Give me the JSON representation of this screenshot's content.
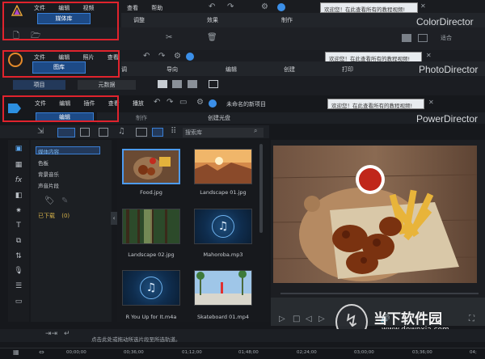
{
  "colordirector": {
    "brand": "ColorDirector",
    "menu": [
      "文件",
      "编辑",
      "视频"
    ],
    "menu_right": [
      "查看",
      "帮助"
    ],
    "library_tab": "媒体库",
    "modes": [
      "调整",
      "效果",
      "制作"
    ],
    "notice": "欢迎您！在此查看所有的教程视频!",
    "fit_select": "适合"
  },
  "photodirector": {
    "brand": "PhotoDirector",
    "menu": [
      "文件",
      "编辑",
      "照片",
      "查看"
    ],
    "library_tab": "图库",
    "modes": [
      "调",
      "导向",
      "编辑",
      "创建",
      "打印"
    ],
    "sub_tabs": [
      "项目",
      "元数据"
    ],
    "notice": "欢迎您！在此查看所有的教程视频!"
  },
  "powerdirector": {
    "brand": "PowerDirector",
    "menu": [
      "文件",
      "编辑",
      "插件",
      "查看",
      "播放"
    ],
    "project_name": "未命名的新项目",
    "modes": [
      "编辑",
      "制作",
      "创建光盘"
    ],
    "notice": "欢迎您！在此查看所有的教程视频!",
    "search_placeholder": "搜索库",
    "tree": [
      "媒体内容",
      "色板",
      "背景音乐",
      "声音片段"
    ],
    "downloaded": "已下载",
    "downloaded_count": "(0)",
    "media": [
      {
        "name": "Food.jpg",
        "kind": "photo-food",
        "selected": true
      },
      {
        "name": "Landscape 01.jpg",
        "kind": "photo-canyon",
        "selected": false
      },
      {
        "name": "Landscape 02.jpg",
        "kind": "photo-forest",
        "selected": false
      },
      {
        "name": "Mahoroba.mp3",
        "kind": "music",
        "selected": false
      },
      {
        "name": "R You Up for It.m4a",
        "kind": "music",
        "selected": false
      },
      {
        "name": "Skateboard 01.mp4",
        "kind": "photo-skate",
        "selected": false
      }
    ],
    "status_hint": "点击此处或拖动所选片段至所选轨道。",
    "timeline_times": [
      "00;00;00",
      "00;36;00",
      "01;12;00",
      "01;48;00",
      "02;24;00",
      "03;00;00",
      "03;36;00",
      "04;"
    ],
    "watermark_site": "www.downxia.com",
    "watermark_brand": "当下软件园"
  }
}
